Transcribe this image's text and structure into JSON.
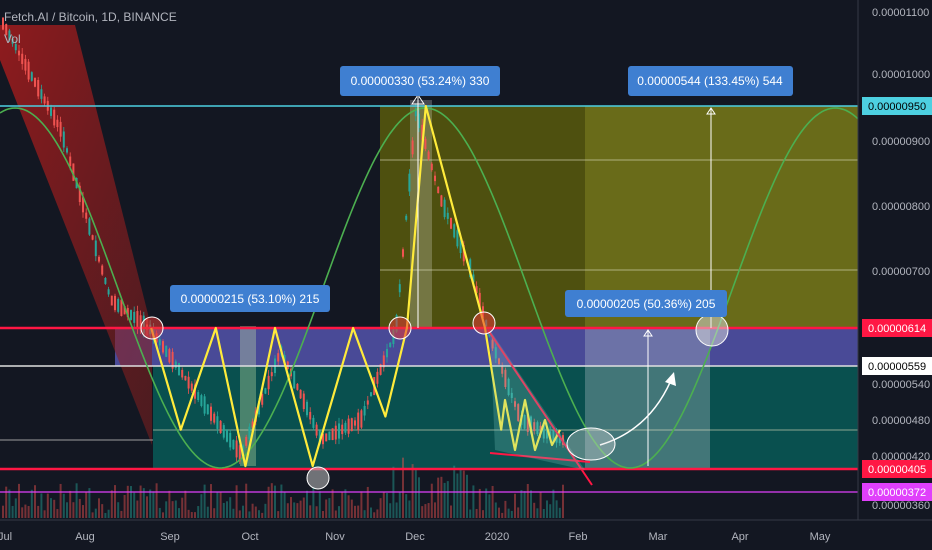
{
  "header": {
    "title": "Fetch.AI / Bitcoin, 1D, BINANCE",
    "volume_label": "Vol"
  },
  "colors": {
    "background": "#131722",
    "up_candle": "#26a69a",
    "down_candle": "#ef5350",
    "zigzag": "#ffeb3b",
    "sine_wave": "#4caf50",
    "resistance_line": "#ff1744",
    "cyan_line": "#4dd0e1",
    "magenta_line": "#e040fb",
    "annotation_box": "#3f7fd1",
    "target_zone": "#808000",
    "teal_zone": "#00897b",
    "purple_zone": "#5c5cbf"
  },
  "chart_data": {
    "type": "candlestick",
    "symbol": "Fetch.AI / Bitcoin",
    "timeframe": "1D",
    "exchange": "BINANCE",
    "ylim": [
      3e-06,
      1.11e-05
    ],
    "y_ticks": [
      "0.00001100",
      "0.00001000",
      "0.00000900",
      "0.00000800",
      "0.00000700",
      "0.00000540",
      "0.00000480",
      "0.00000420",
      "0.00000360"
    ],
    "x_ticks": [
      "Jul",
      "Aug",
      "Sep",
      "Oct",
      "Nov",
      "Dec",
      "2020",
      "Feb",
      "Mar",
      "Apr",
      "May"
    ],
    "price_labels": [
      {
        "text": "0.00000950",
        "value": 9.5e-06,
        "role": "cyan"
      },
      {
        "text": "0.00000614",
        "value": 6.14e-06,
        "role": "red"
      },
      {
        "text": "0.00000559",
        "value": 5.59e-06,
        "role": "white"
      },
      {
        "text": "0.00000405",
        "value": 4.05e-06,
        "role": "red"
      },
      {
        "text": "0.00000372",
        "value": 3.72e-06,
        "role": "magenta"
      }
    ],
    "annotations": [
      {
        "text": "0.00000215 (53.10%) 215"
      },
      {
        "text": "0.00000330 (53.24%) 330"
      },
      {
        "text": "0.00000544 (133.45%) 544"
      },
      {
        "text": "0.00000205 (50.36%) 205"
      }
    ],
    "zigzag_pattern": [
      {
        "date": "2019-08-25",
        "price": 6.14e-06
      },
      {
        "date": "2019-09-05",
        "price": 4.6e-06
      },
      {
        "date": "2019-09-18",
        "price": 6.14e-06
      },
      {
        "date": "2019-09-29",
        "price": 4.05e-06
      },
      {
        "date": "2019-10-10",
        "price": 6.14e-06
      },
      {
        "date": "2019-10-24",
        "price": 4.05e-06
      },
      {
        "date": "2019-11-08",
        "price": 6.14e-06
      },
      {
        "date": "2019-11-20",
        "price": 4.8e-06
      },
      {
        "date": "2019-11-28",
        "price": 6.14e-06
      },
      {
        "date": "2019-12-05",
        "price": 9.5e-06
      },
      {
        "date": "2019-12-27",
        "price": 6.14e-06
      },
      {
        "date": "2020-01-02",
        "price": 4.6e-06
      }
    ]
  }
}
